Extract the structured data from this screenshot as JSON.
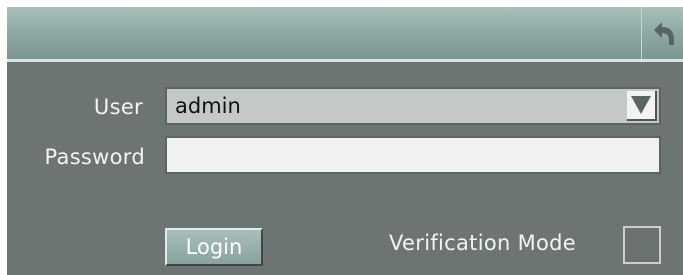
{
  "header": {
    "back_icon": "undo-arrow-icon"
  },
  "form": {
    "user_label": "User",
    "user_value": "admin",
    "user_dropdown_icon": "triangle-down-icon",
    "password_label": "Password",
    "password_value": "",
    "login_label": "Login",
    "verification_label": "Verification Mode",
    "verification_checked": false
  },
  "colors": {
    "panel_bg": "#6c7573",
    "titlebar_top": "#a8c1bd",
    "titlebar_bottom": "#7d9691",
    "text": "#f1f4f3",
    "accent_button": "#8aa29e"
  }
}
